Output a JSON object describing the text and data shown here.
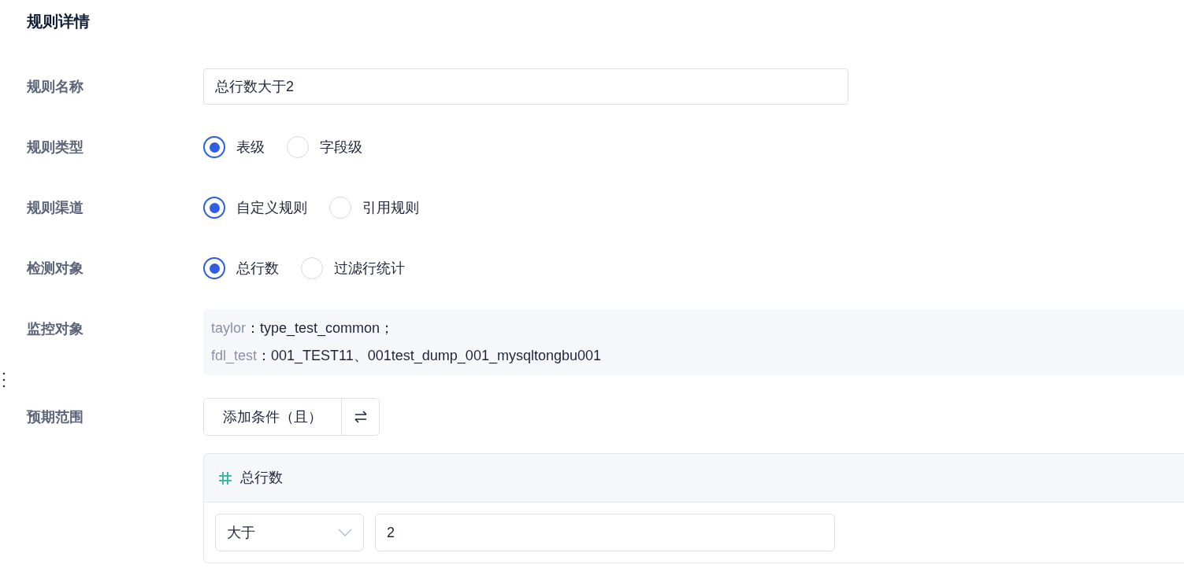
{
  "title": "规则详情",
  "name_field": {
    "label": "规则名称",
    "value": "总行数大于2"
  },
  "radio_rows": [
    {
      "label": "规则类型",
      "options": [
        {
          "label": "表级",
          "selected": true
        },
        {
          "label": "字段级",
          "selected": false
        }
      ]
    },
    {
      "label": "规则渠道",
      "options": [
        {
          "label": "自定义规则",
          "selected": true
        },
        {
          "label": "引用规则",
          "selected": false
        }
      ]
    },
    {
      "label": "检测对象",
      "options": [
        {
          "label": "总行数",
          "selected": true
        },
        {
          "label": "过滤行统计",
          "selected": false
        }
      ]
    }
  ],
  "monitor": {
    "label": "监控对象",
    "lines": [
      {
        "source": "taylor",
        "separator": "：",
        "tables": "type_test_common；"
      },
      {
        "source": "fdl_test",
        "separator": "：",
        "tables": "001_TEST11、001test_dump_001_mysqltongbu001"
      }
    ]
  },
  "expected_range": {
    "label": "预期范围",
    "add_button": "添加条件（且）",
    "condition": {
      "metric": "总行数",
      "operator": "大于",
      "value": "2"
    }
  }
}
